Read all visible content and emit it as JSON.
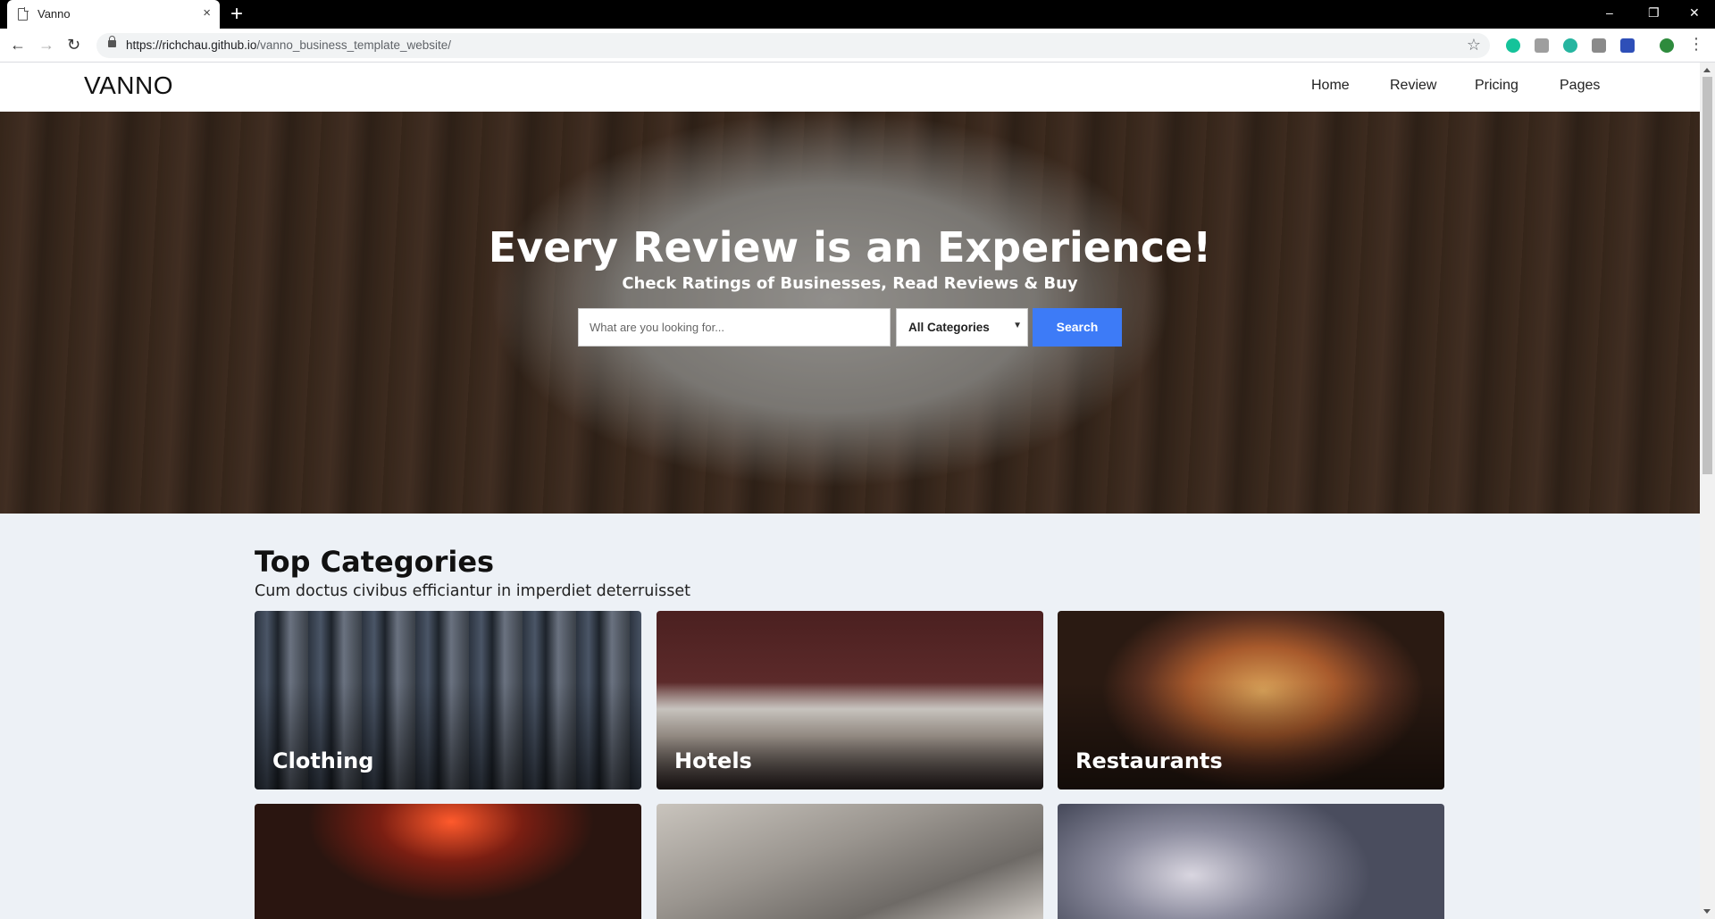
{
  "browser": {
    "tab_title": "Vanno",
    "tab_close": "×",
    "new_tab": "+",
    "url_host": "https://richchau.github.io",
    "url_path": "/vanno_business_template_website/",
    "bookmark_icon": "☆",
    "window_controls": [
      "–",
      "❐",
      "✕"
    ],
    "nav": {
      "back": "←",
      "forward": "→",
      "reload": "↻"
    },
    "extensions": [
      {
        "name": "grammarly-icon",
        "color": "#15c39a"
      },
      {
        "name": "extension-k-icon",
        "color": "#9e9e9e"
      },
      {
        "name": "extension-m-icon",
        "color": "#26b5a0"
      },
      {
        "name": "camera-icon",
        "color": "#8a8a8a"
      },
      {
        "name": "extension-blue-k-icon",
        "color": "#2e4fb8"
      },
      {
        "name": "profile-avatar-icon",
        "color": "#2e8b3d"
      }
    ],
    "menu_icon": "⋮"
  },
  "site": {
    "logo": "VANNO",
    "nav": [
      "Home",
      "Review",
      "Pricing",
      "Pages"
    ]
  },
  "hero": {
    "title": "Every Review is an Experience!",
    "subtitle": "Check Ratings of Businesses, Read Reviews & Buy",
    "search_placeholder": "What are you looking for...",
    "category_selected": "All Categories",
    "category_caret": "▼",
    "search_button": "Search"
  },
  "categories": {
    "title": "Top Categories",
    "subtitle": "Cum doctus civibus efficiantur in imperdiet deterruisset",
    "cards": [
      {
        "label": "Clothing"
      },
      {
        "label": "Hotels"
      },
      {
        "label": "Restaurants"
      },
      {
        "label": ""
      },
      {
        "label": ""
      },
      {
        "label": ""
      }
    ]
  },
  "colors": {
    "accent": "#3d7bf7",
    "page_bg": "#edf1f6"
  }
}
